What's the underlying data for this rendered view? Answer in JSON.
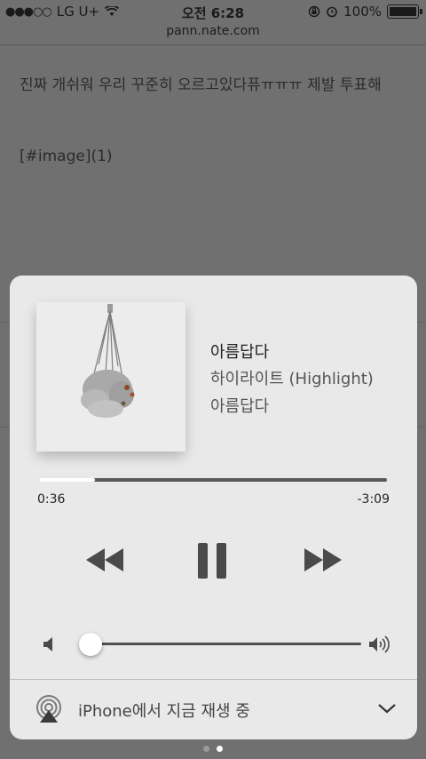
{
  "status_bar": {
    "carrier": "LG U+",
    "time": "오전 6:28",
    "battery": "100%"
  },
  "browser": {
    "url": "pann.nate.com",
    "post_text": "진짜 개쉬워 우리 꾸준히 오르고있다퓨ㅠㅠㅠ 제발 투표해",
    "post_image_placeholder": "[#image](1)"
  },
  "now_playing": {
    "title": "아름답다",
    "artist": "하이라이트 (Highlight)",
    "album": "아름답다",
    "elapsed": "0:36",
    "remaining": "-3:09",
    "progress_fraction": 0.16,
    "volume_fraction": 0.04
  },
  "output": {
    "device_label": "iPhone에서 지금 재생 중"
  },
  "pager": {
    "pages": 2,
    "current": 2
  },
  "colors": {
    "card_bg": "#e9e9e9",
    "dim_bg": "#707070"
  }
}
